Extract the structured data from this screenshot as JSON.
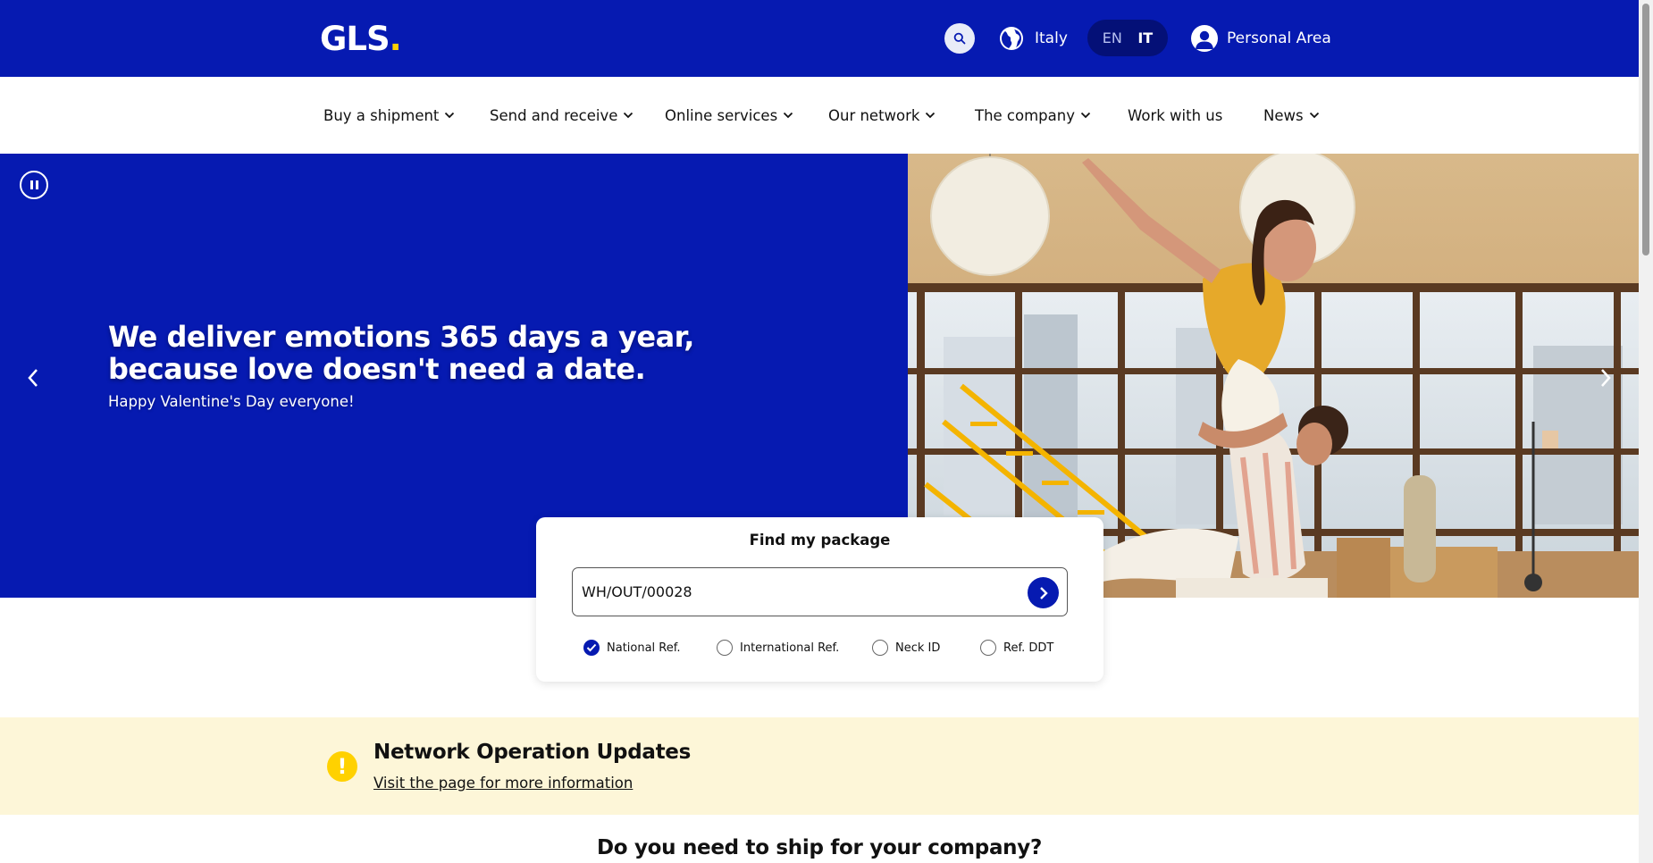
{
  "header": {
    "logo_text": "GLS",
    "logo_dot": ".",
    "country": "Italy",
    "lang_en": "EN",
    "lang_it": "IT",
    "personal_area": "Personal Area"
  },
  "nav": {
    "items": [
      {
        "label": "Buy a shipment",
        "dropdown": true
      },
      {
        "label": "Send and receive",
        "dropdown": true
      },
      {
        "label": "Online services",
        "dropdown": true
      },
      {
        "label": "Our network",
        "dropdown": true
      },
      {
        "label": "The company",
        "dropdown": true
      },
      {
        "label": "Work with us",
        "dropdown": false
      },
      {
        "label": "News",
        "dropdown": true
      }
    ]
  },
  "hero": {
    "title_line1": "We deliver emotions 365 days a year,",
    "title_line2": "because love doesn't need a date.",
    "subtitle": "Happy Valentine's Day everyone!"
  },
  "tracking": {
    "title": "Find my package",
    "input_value": "WH/OUT/00028",
    "options": [
      {
        "label": "National Ref.",
        "selected": true
      },
      {
        "label": "International Ref.",
        "selected": false
      },
      {
        "label": "Neck ID",
        "selected": false
      },
      {
        "label": "Ref. DDT",
        "selected": false
      }
    ]
  },
  "notice": {
    "title": "Network Operation Updates",
    "link": "Visit the page for more information"
  },
  "section": {
    "title": "Do you need to ship for your company?"
  },
  "colors": {
    "brand_blue": "#061ab1",
    "brand_yellow": "#ffd100",
    "notice_bg": "#fdf6d8"
  },
  "icons": [
    "search-icon",
    "globe-icon",
    "user-icon",
    "chevron-down-icon",
    "pause-icon",
    "chevron-left-icon",
    "chevron-right-icon",
    "arrow-right-icon",
    "check-icon",
    "exclamation-icon"
  ]
}
